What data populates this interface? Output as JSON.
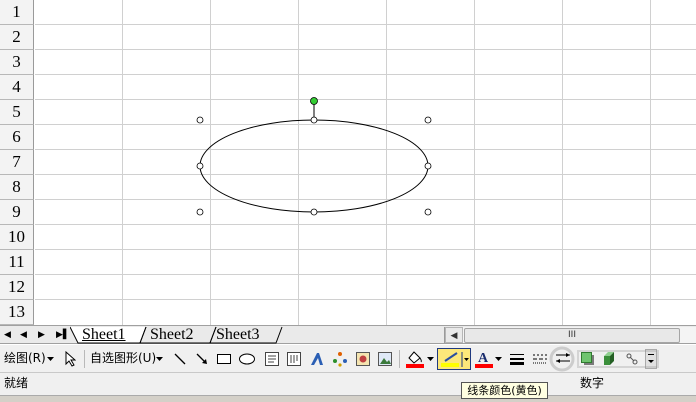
{
  "sheet": {
    "rows": [
      "1",
      "2",
      "3",
      "4",
      "5",
      "6",
      "7",
      "8",
      "9",
      "10",
      "11",
      "12",
      "13"
    ]
  },
  "tabs": {
    "sheets": [
      "Sheet1",
      "Sheet2",
      "Sheet3"
    ],
    "scroll_thumb": "III"
  },
  "toolbar": {
    "draw_menu": "绘图(R)",
    "autoshapes_menu": "自选图形(U)",
    "icons": [
      "dropdown-arrow-icon",
      "select-pointer-icon",
      "line-icon",
      "arrow-icon",
      "rectangle-icon",
      "oval-icon",
      "textbox-icon",
      "vertical-textbox-icon",
      "wordart-icon",
      "diagram-icon",
      "clipart-icon",
      "picture-icon",
      "fill-color-icon",
      "line-color-icon",
      "font-color-icon",
      "line-style-icon",
      "dash-style-icon",
      "arrow-style-icon",
      "shadow-icon",
      "3d-icon",
      "watermark-icon"
    ],
    "colors": {
      "fill": "#ff0000",
      "line": "#ffff00",
      "font": "#ff0000",
      "selected_bg": "#fde87a"
    }
  },
  "statusbar": {
    "left": "就绪",
    "right": "数字"
  },
  "tooltip": "线条颜色(黄色)",
  "shape": {
    "type": "oval",
    "handle_color": "#33cc33"
  }
}
